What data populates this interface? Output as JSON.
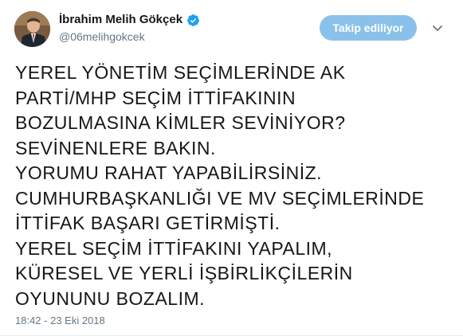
{
  "author": {
    "display_name": "İbrahim Melih Gökçek",
    "handle": "@06melihgokcek",
    "verified_icon": "verified-badge-icon",
    "avatar_icon": "profile-avatar"
  },
  "actions": {
    "follow_label": "Takip ediliyor",
    "more_icon": "chevron-down-icon"
  },
  "tweet": {
    "lines": [
      "YEREL YÖNETİM SEÇİMLERİNDE AK",
      "PARTİ/MHP SEÇİM İTTİFAKININ",
      "BOZULMASINA KİMLER SEVİNİYOR?",
      "SEVİNENLERE BAKIN.",
      "YORUMU RAHAT YAPABİLİRSİNİZ.",
      "CUMHURBAŞKANLIĞI VE MV SEÇİMLERİNDE",
      "İTTİFAK BAŞARI GETİRMİŞTİ.",
      "YEREL SEÇİM İTTİFAKINI YAPALIM,",
      "KÜRESEL VE YERLİ İŞBİRLİKÇİLERİN",
      "OYUNUNU BOZALIM."
    ],
    "timestamp": "18:42 - 23 Eki 2018"
  },
  "colors": {
    "follow_button_bg": "#8ac1ea",
    "verified_blue": "#1da1f2",
    "text": "#14171a",
    "muted": "#657786"
  }
}
